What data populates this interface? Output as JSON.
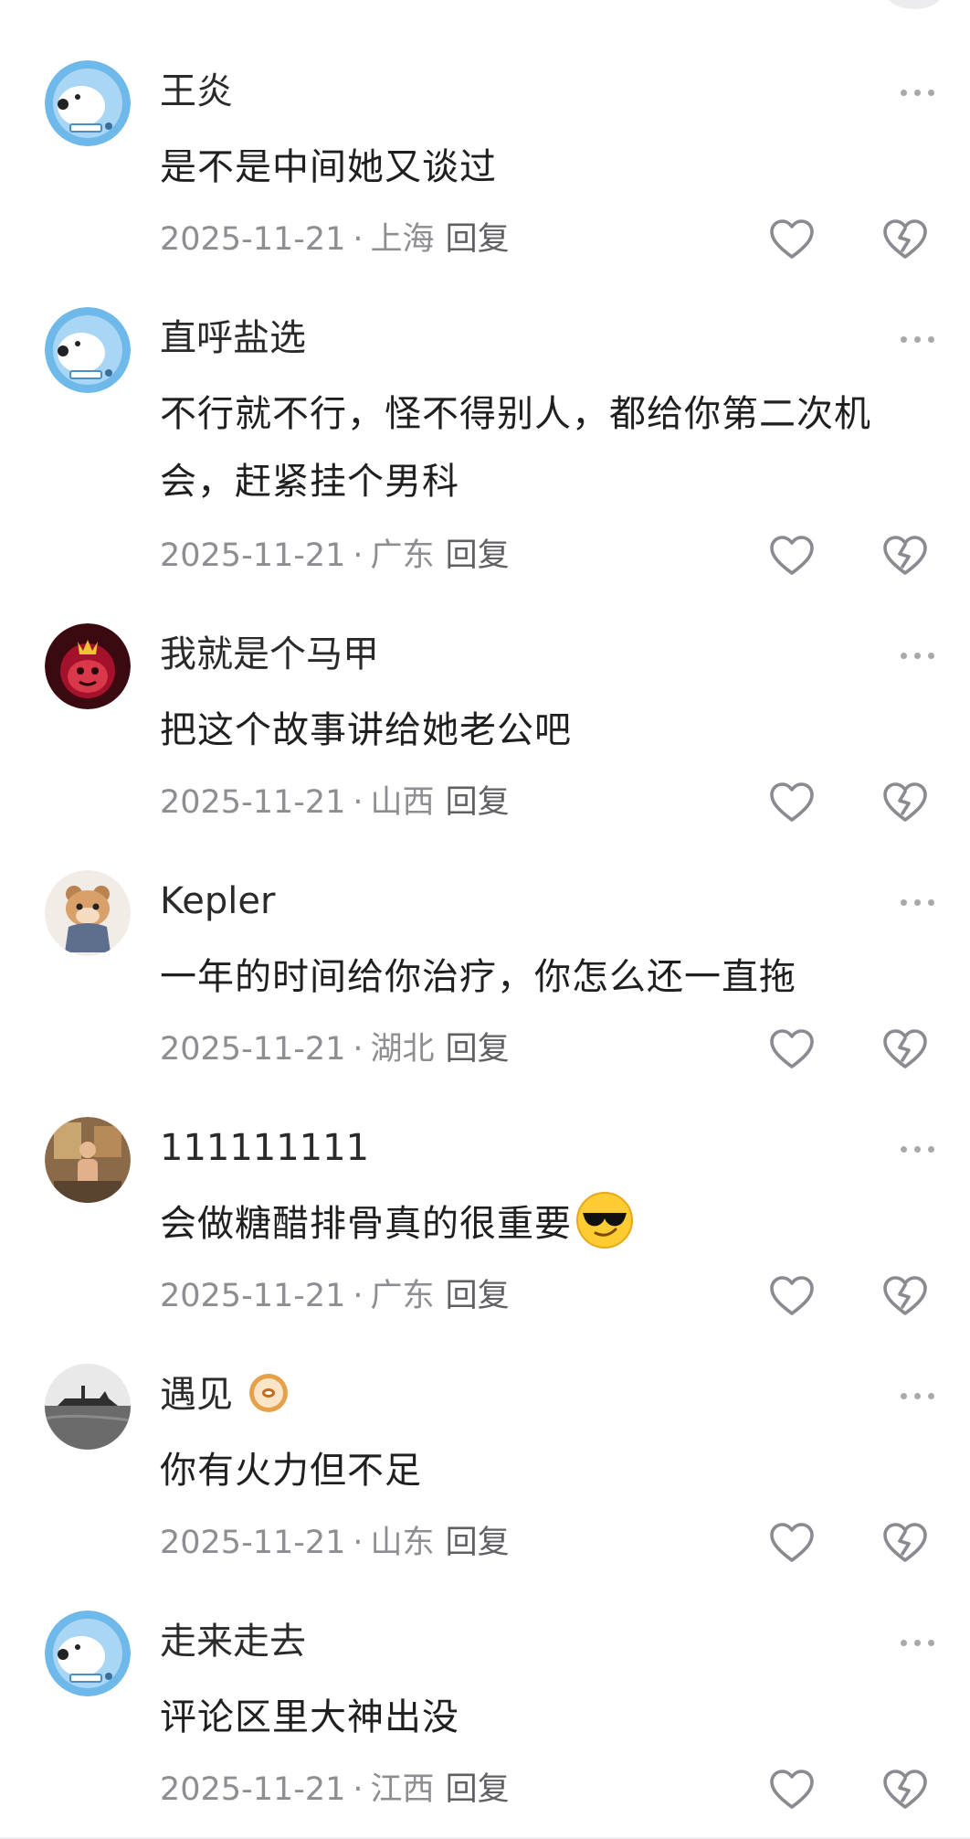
{
  "comments": [
    {
      "username": "王炎",
      "text": "是不是中间她又谈过",
      "date": "2025-11-21",
      "location": "上海",
      "reply_label": "回复",
      "avatar": "polar-bear-avatar",
      "emoji": null,
      "badge": false
    },
    {
      "username": "直呼盐选",
      "text": "不行就不行，怪不得别人，都给你第二次机会，赶紧挂个男科",
      "date": "2025-11-21",
      "location": "广东",
      "reply_label": "回复",
      "avatar": "polar-bear-avatar",
      "emoji": null,
      "badge": false
    },
    {
      "username": "我就是个马甲",
      "text": "把这个故事讲给她老公吧",
      "date": "2025-11-21",
      "location": "山西",
      "reply_label": "回复",
      "avatar": "red-crowned-character-avatar",
      "emoji": null,
      "badge": false
    },
    {
      "username": "Kepler",
      "text": "一年的时间给你治疗，你怎么还一直拖",
      "date": "2025-11-21",
      "location": "湖北",
      "reply_label": "回复",
      "avatar": "hamster-avatar",
      "emoji": null,
      "badge": false
    },
    {
      "username": "111111111",
      "text": "会做糖醋排骨真的很重要",
      "date": "2025-11-21",
      "location": "广东",
      "reply_label": "回复",
      "avatar": "mirror-selfie-avatar",
      "emoji": "sunglasses-emoji",
      "badge": false
    },
    {
      "username": "遇见",
      "text": "你有火力但不足",
      "date": "2025-11-21",
      "location": "山东",
      "reply_label": "回复",
      "avatar": "ship-photo-avatar",
      "emoji": null,
      "badge": true
    },
    {
      "username": "走来走去",
      "text": "评论区里大神出没",
      "date": "2025-11-21",
      "location": "江西",
      "reply_label": "回复",
      "avatar": "polar-bear-avatar",
      "emoji": null,
      "badge": false
    }
  ],
  "icons": {
    "more": "more-dots-icon",
    "like": "heart-outline-icon",
    "dislike": "broken-heart-icon"
  },
  "colors": {
    "text": "#1f1f1f",
    "meta": "#8d8d92",
    "icon": "#8a8a90"
  }
}
